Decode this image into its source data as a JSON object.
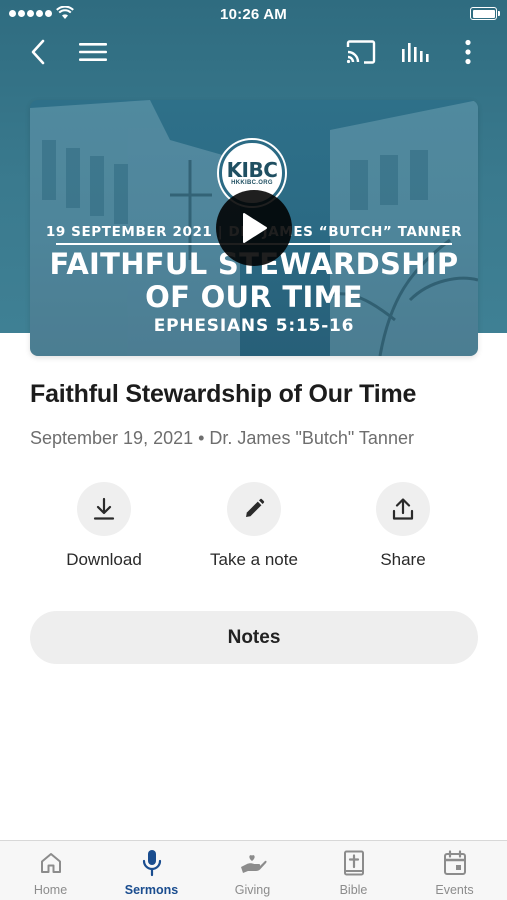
{
  "status_bar": {
    "time": "10:26 AM"
  },
  "nav": {
    "back_icon": "chevron-left-icon",
    "menu_icon": "hamburger-menu-icon",
    "cast_icon": "cast-icon",
    "audio_icon": "audio-bars-icon",
    "more_icon": "more-vertical-icon"
  },
  "artwork": {
    "logo": "KIBC",
    "logo_sub": "HKKIBC.ORG",
    "dateline": "19 SEPTEMBER 2021 | DR. JAMES “BUTCH” TANNER",
    "title_line1": "FAITHFUL STEWARDSHIP",
    "title_line2": "OF OUR TIME",
    "reference": "EPHESIANS 5:15-16",
    "play_icon": "play-icon"
  },
  "sermon": {
    "title": "Faithful Stewardship of Our Time",
    "meta": "September 19, 2021 • Dr. James \"Butch\" Tanner"
  },
  "actions": [
    {
      "label": "Download",
      "icon": "download-icon"
    },
    {
      "label": "Take a note",
      "icon": "pencil-icon"
    },
    {
      "label": "Share",
      "icon": "share-icon"
    }
  ],
  "notes_button": {
    "label": "Notes"
  },
  "tabs": [
    {
      "label": "Home",
      "icon": "home-icon",
      "active": false
    },
    {
      "label": "Sermons",
      "icon": "microphone-icon",
      "active": true
    },
    {
      "label": "Giving",
      "icon": "giving-hand-icon",
      "active": false
    },
    {
      "label": "Bible",
      "icon": "bible-icon",
      "active": false
    },
    {
      "label": "Events",
      "icon": "calendar-icon",
      "active": false
    }
  ],
  "colors": {
    "header": "#2f6c80",
    "active_tab": "#1a4d8f",
    "inactive_tab": "#8c8c8c"
  }
}
